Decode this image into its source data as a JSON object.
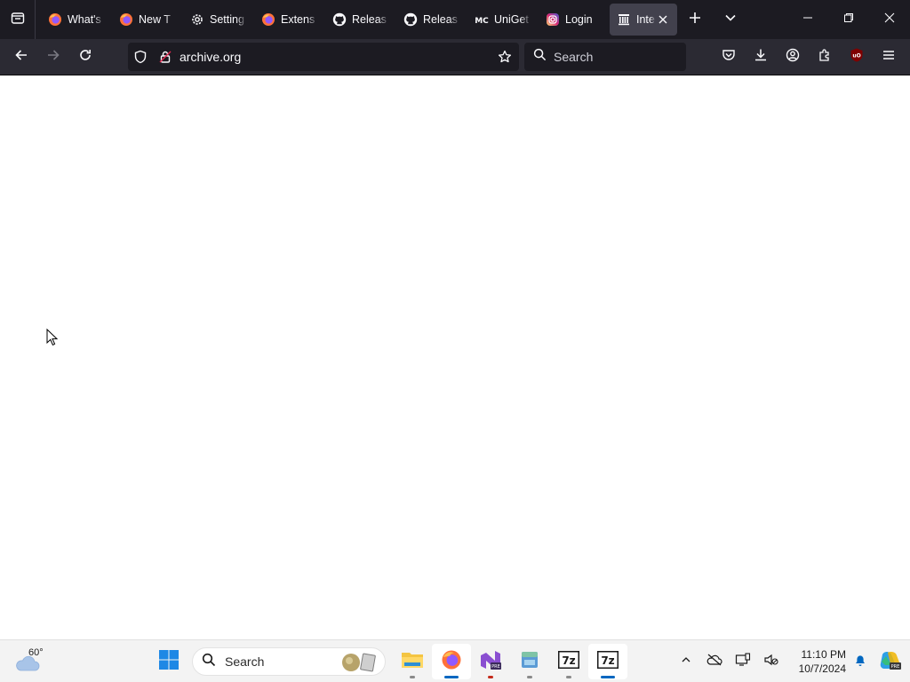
{
  "browser": {
    "tabs": [
      {
        "title": "What's",
        "icon": "firefox-icon"
      },
      {
        "title": "New T",
        "icon": "firefox-icon"
      },
      {
        "title": "Setting",
        "icon": "gear-icon"
      },
      {
        "title": "Extens",
        "icon": "firefox-icon"
      },
      {
        "title": "Releas",
        "icon": "github-icon"
      },
      {
        "title": "Releas",
        "icon": "github-icon"
      },
      {
        "title": "UniGet",
        "icon": "unigetui-icon",
        "icon_text": "MC"
      },
      {
        "title": "Login",
        "icon": "instagram-icon"
      },
      {
        "title": "Inte",
        "icon": "internet-archive-icon",
        "active": true
      }
    ],
    "url": "archive.org",
    "search_placeholder": "Search",
    "extension_badge": "uO"
  },
  "taskbar": {
    "weather_temp": "60°",
    "search_placeholder": "Search",
    "apps": [
      {
        "name": "file-explorer-icon",
        "running": true
      },
      {
        "name": "firefox-icon",
        "running": true,
        "active": true
      },
      {
        "name": "visual-studio-preview-icon",
        "running": true
      },
      {
        "name": "app-icon",
        "running": true
      },
      {
        "name": "7zip-icon",
        "label": "7z",
        "running": true
      },
      {
        "name": "7zip-icon",
        "label": "7z",
        "running": true,
        "active": true
      }
    ],
    "clock_time": "11:10 PM",
    "clock_date": "10/7/2024",
    "copilot_badge": "PRE"
  },
  "colors": {
    "tab_bar_bg": "#1c1b22",
    "nav_bar_bg": "#2b2a33",
    "active_tab_bg": "#42414d",
    "taskbar_bg": "#f3f3f3",
    "accent_blue": "#0067c0"
  }
}
